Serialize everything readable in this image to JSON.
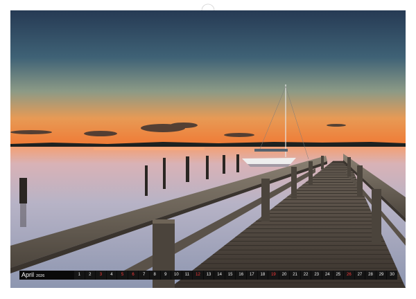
{
  "calendar": {
    "month": "April",
    "year": "2026",
    "days": [
      {
        "d": "1",
        "holiday": false
      },
      {
        "d": "2",
        "holiday": false
      },
      {
        "d": "3",
        "holiday": true
      },
      {
        "d": "4",
        "holiday": false
      },
      {
        "d": "5",
        "holiday": true
      },
      {
        "d": "6",
        "holiday": true
      },
      {
        "d": "7",
        "holiday": false
      },
      {
        "d": "8",
        "holiday": false
      },
      {
        "d": "9",
        "holiday": false
      },
      {
        "d": "10",
        "holiday": false
      },
      {
        "d": "11",
        "holiday": false
      },
      {
        "d": "12",
        "holiday": true
      },
      {
        "d": "13",
        "holiday": false
      },
      {
        "d": "14",
        "holiday": false
      },
      {
        "d": "15",
        "holiday": false
      },
      {
        "d": "16",
        "holiday": false
      },
      {
        "d": "17",
        "holiday": false
      },
      {
        "d": "18",
        "holiday": false
      },
      {
        "d": "19",
        "holiday": true
      },
      {
        "d": "20",
        "holiday": false
      },
      {
        "d": "21",
        "holiday": false
      },
      {
        "d": "22",
        "holiday": false
      },
      {
        "d": "23",
        "holiday": false
      },
      {
        "d": "24",
        "holiday": false
      },
      {
        "d": "25",
        "holiday": false
      },
      {
        "d": "26",
        "holiday": true
      },
      {
        "d": "27",
        "holiday": false
      },
      {
        "d": "28",
        "holiday": false
      },
      {
        "d": "29",
        "holiday": false
      },
      {
        "d": "30",
        "holiday": false
      }
    ]
  },
  "colors": {
    "sky_top": "#2a3b55",
    "sky_horizon": "#f08a3c",
    "water": "#b9a9b8",
    "holiday": "#ff3a3a",
    "strip_bg": "#0a0a0a"
  }
}
